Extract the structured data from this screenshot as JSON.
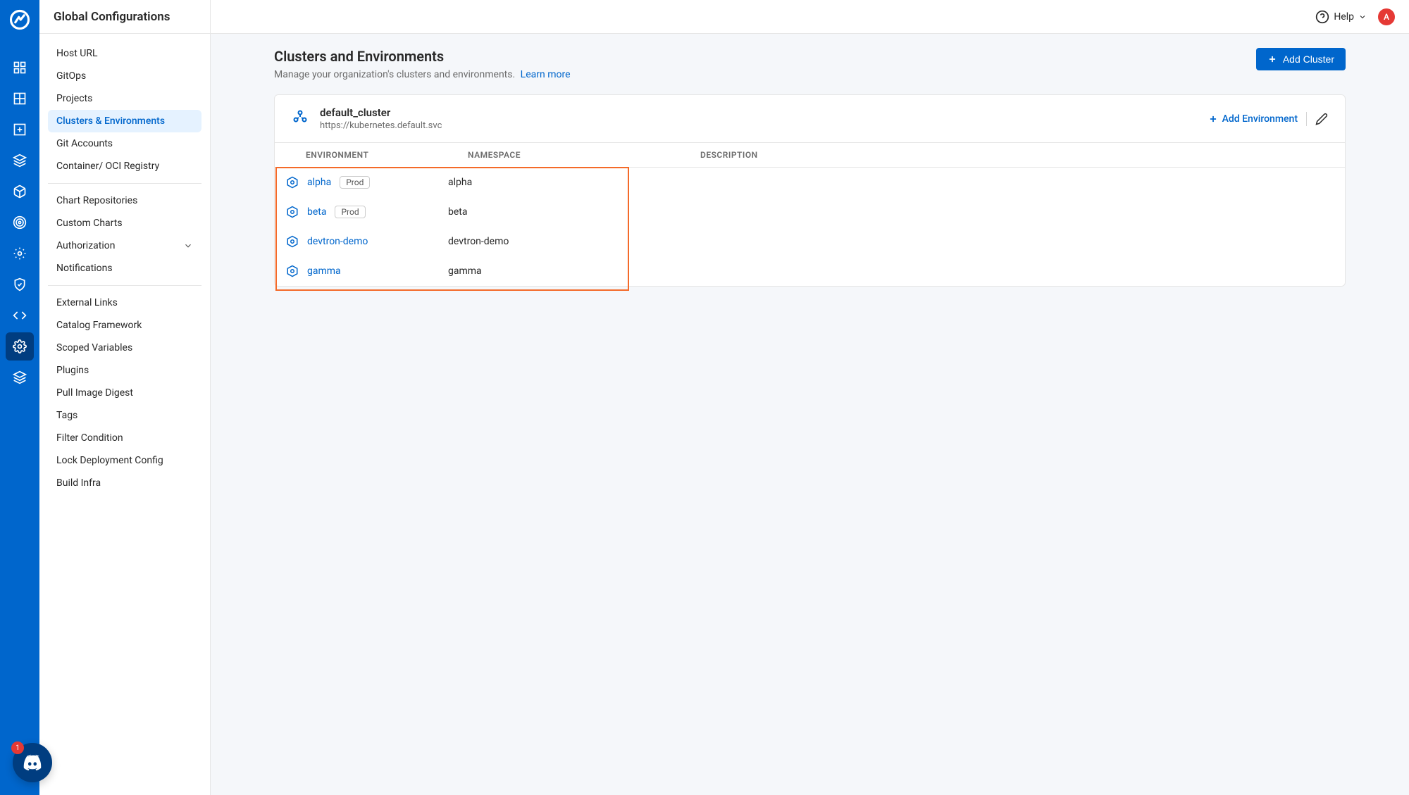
{
  "topbar": {
    "title": "Global Configurations",
    "help_label": "Help",
    "avatar_initial": "A"
  },
  "sidebar": {
    "groups": [
      {
        "items": [
          "Host URL",
          "GitOps",
          "Projects",
          "Clusters & Environments",
          "Git Accounts",
          "Container/ OCI Registry"
        ]
      },
      {
        "items": [
          "Chart Repositories",
          "Custom Charts",
          "Authorization",
          "Notifications"
        ]
      },
      {
        "items": [
          "External Links",
          "Catalog Framework",
          "Scoped Variables",
          "Plugins",
          "Pull Image Digest",
          "Tags",
          "Filter Condition",
          "Lock Deployment Config",
          "Build Infra"
        ]
      }
    ],
    "active": "Clusters & Environments",
    "expandable": [
      "Authorization"
    ]
  },
  "page": {
    "title": "Clusters and Environments",
    "subtitle": "Manage your organization's clusters and environments.",
    "learn_more": "Learn more",
    "add_cluster": "Add Cluster"
  },
  "cluster": {
    "name": "default_cluster",
    "url": "https://kubernetes.default.svc",
    "add_env": "Add Environment",
    "columns": {
      "env": "ENVIRONMENT",
      "ns": "NAMESPACE",
      "desc": "DESCRIPTION"
    },
    "envs": [
      {
        "name": "alpha",
        "prod": true,
        "namespace": "alpha",
        "description": ""
      },
      {
        "name": "beta",
        "prod": true,
        "namespace": "beta",
        "description": ""
      },
      {
        "name": "devtron-demo",
        "prod": false,
        "namespace": "devtron-demo",
        "description": ""
      },
      {
        "name": "gamma",
        "prod": false,
        "namespace": "gamma",
        "description": ""
      }
    ],
    "prod_badge": "Prod"
  },
  "discord": {
    "badge": "1"
  }
}
